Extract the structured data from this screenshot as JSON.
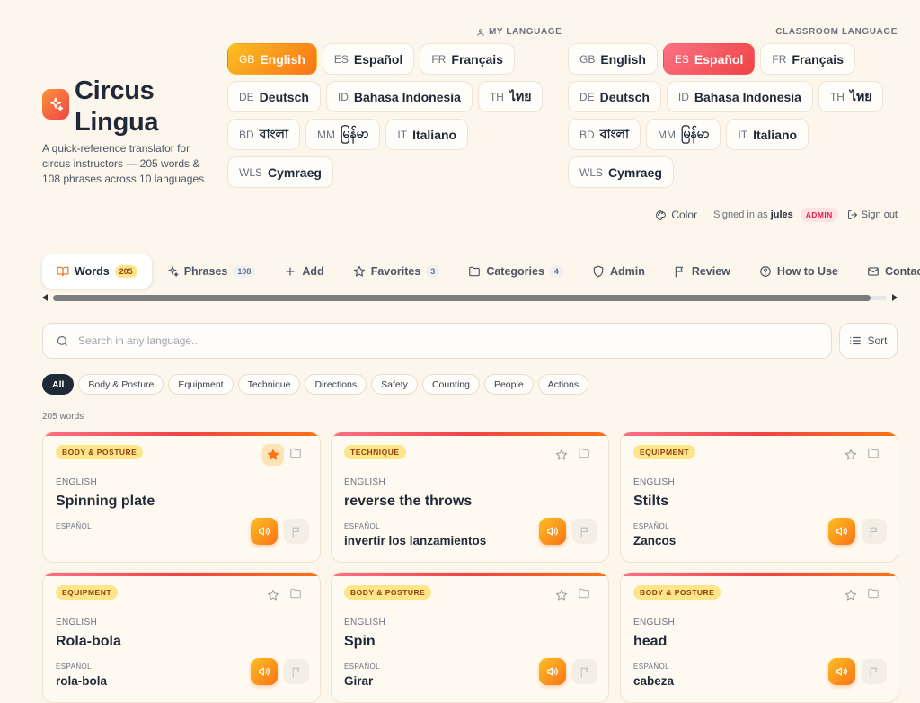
{
  "brand": {
    "title": "Circus Lingua",
    "description": "A quick-reference translator for circus instructors — 205 words & 108 phrases across 10 languages."
  },
  "my_language": {
    "label": "MY LANGUAGE",
    "selected": "English",
    "options": [
      {
        "code": "GB",
        "name": "English"
      },
      {
        "code": "ES",
        "name": "Español"
      },
      {
        "code": "FR",
        "name": "Français"
      },
      {
        "code": "DE",
        "name": "Deutsch"
      },
      {
        "code": "ID",
        "name": "Bahasa Indonesia"
      },
      {
        "code": "TH",
        "name": "ไทย"
      },
      {
        "code": "BD",
        "name": "বাংলা"
      },
      {
        "code": "MM",
        "name": "မြန်မာ"
      },
      {
        "code": "IT",
        "name": "Italiano"
      },
      {
        "code": "WLS",
        "name": "Cymraeg"
      }
    ]
  },
  "classroom_language": {
    "label": "CLASSROOM LANGUAGE",
    "selected": "Español",
    "options": [
      {
        "code": "GB",
        "name": "English"
      },
      {
        "code": "ES",
        "name": "Español"
      },
      {
        "code": "FR",
        "name": "Français"
      },
      {
        "code": "DE",
        "name": "Deutsch"
      },
      {
        "code": "ID",
        "name": "Bahasa Indonesia"
      },
      {
        "code": "TH",
        "name": "ไทย"
      },
      {
        "code": "BD",
        "name": "বাংলা"
      },
      {
        "code": "MM",
        "name": "မြန်မာ"
      },
      {
        "code": "IT",
        "name": "Italiano"
      },
      {
        "code": "WLS",
        "name": "Cymraeg"
      }
    ]
  },
  "user": {
    "color_label": "Color",
    "signed_in_prefix": "Signed in as",
    "username": "jules",
    "role_badge": "ADMIN",
    "signout_label": "Sign out"
  },
  "tabs": [
    {
      "label": "Words",
      "count": "205",
      "icon": "book-icon",
      "active": true
    },
    {
      "label": "Phrases",
      "count": "108",
      "icon": "sparkles-icon"
    },
    {
      "label": "Add",
      "icon": "plus-icon"
    },
    {
      "label": "Favorites",
      "count": "3",
      "icon": "star-icon"
    },
    {
      "label": "Categories",
      "count": "4",
      "icon": "folder-icon"
    },
    {
      "label": "Admin",
      "icon": "shield-icon"
    },
    {
      "label": "Review",
      "icon": "flag-icon"
    },
    {
      "label": "How to Use",
      "icon": "help-circle-icon"
    },
    {
      "label": "Contact",
      "icon": "mail-icon"
    }
  ],
  "search": {
    "placeholder": "Search in any language...",
    "value": "",
    "sort_label": "Sort"
  },
  "filters": {
    "selected": "All",
    "chips": [
      "All",
      "Body & Posture",
      "Equipment",
      "Technique",
      "Directions",
      "Safety",
      "Counting",
      "People",
      "Actions"
    ]
  },
  "results_count": "205 words",
  "cards": [
    {
      "tag": "BODY & POSTURE",
      "source_lang": "ENGLISH",
      "word": "Spinning plate",
      "target_lang": "ESPAÑOL",
      "translation": "",
      "favorited": true
    },
    {
      "tag": "TECHNIQUE",
      "source_lang": "ENGLISH",
      "word": "reverse the throws",
      "target_lang": "ESPAÑOL",
      "translation": "invertir los lanzamientos",
      "favorited": false
    },
    {
      "tag": "EQUIPMENT",
      "source_lang": "ENGLISH",
      "word": "Stilts",
      "target_lang": "ESPAÑOL",
      "translation": "Zancos",
      "favorited": false
    },
    {
      "tag": "EQUIPMENT",
      "source_lang": "ENGLISH",
      "word": "Rola-bola",
      "target_lang": "ESPAÑOL",
      "translation": "rola-bola",
      "favorited": false
    },
    {
      "tag": "BODY & POSTURE",
      "source_lang": "ENGLISH",
      "word": "Spin",
      "target_lang": "ESPAÑOL",
      "translation": "Girar",
      "favorited": false
    },
    {
      "tag": "BODY & POSTURE",
      "source_lang": "ENGLISH",
      "word": "head",
      "target_lang": "ESPAÑOL",
      "translation": "cabeza",
      "favorited": false
    }
  ],
  "colors": {
    "accent_orange": "#f97316",
    "accent_red": "#ef4444",
    "background": "#fdf6ec"
  }
}
